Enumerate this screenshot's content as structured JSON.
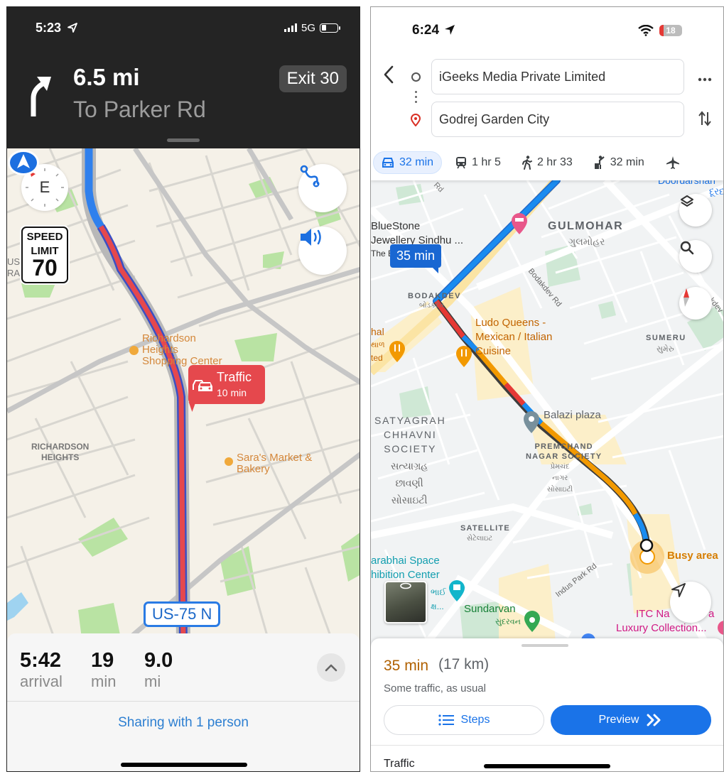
{
  "left": {
    "app": "Apple Maps navigation",
    "status_bar": {
      "time": "5:23",
      "network": "5G",
      "location_icon": "location-arrow-icon"
    },
    "guidance": {
      "maneuver_icon": "turn-slight-right-arrow-icon",
      "distance": "6.5 mi",
      "road": "To Parker Rd",
      "exit_badge": "Exit 30"
    },
    "map": {
      "compass_heading": "E",
      "speed_limit": {
        "line1": "SPEED",
        "line2": "LIMIT",
        "value": "70"
      },
      "buttons": [
        {
          "name": "route-overview-button",
          "icon": "route-icon"
        },
        {
          "name": "audio-button",
          "icon": "speaker-icon"
        }
      ],
      "traffic_callout": {
        "title": "Traffic",
        "delay": "10 min",
        "icon": "cars-icon"
      },
      "labels": {
        "poi_1": [
          "Richardson",
          "Heights",
          "Shopping Center"
        ],
        "poi_2": [
          "Sara's Market &",
          "Bakery"
        ],
        "area": [
          "RICHARDSON",
          "HEIGHTS"
        ],
        "edge_left": [
          "UST",
          "RAI"
        ]
      },
      "road_shield": "US-75 N"
    },
    "trip_card": {
      "arrival_value": "5:42",
      "arrival_label": "arrival",
      "minutes_value": "19",
      "minutes_label": "min",
      "miles_value": "9.0",
      "miles_label": "mi",
      "expand_icon": "chevron-up-icon",
      "share_text": "Sharing with 1 person"
    }
  },
  "right": {
    "app": "Google Maps directions",
    "status_bar": {
      "time": "6:24",
      "battery": "18"
    },
    "origin": "iGeeks Media Private Limited",
    "destination": "Godrej Garden City",
    "modes": [
      {
        "icon": "car-icon",
        "label": "32 min",
        "active": true
      },
      {
        "icon": "transit-icon",
        "label": "1 hr 5"
      },
      {
        "icon": "walk-icon",
        "label": "2 hr 33"
      },
      {
        "icon": "ride-hail-icon",
        "label": "32 min"
      },
      {
        "icon": "flight-icon",
        "label": ""
      }
    ],
    "map": {
      "eta_callout": "35 min",
      "labels": {
        "doordarshan": "Doordarshan",
        "doordarshan_guj": "દૂરદ",
        "rd_top": "Rd",
        "bluestone_1": "BlueStone",
        "bluestone_2": "Jewellery Sindhu ...",
        "bluestone_3": "The B",
        "gulmohar": "GULMOHAR",
        "gulmohar_guj": "ગુલમોહર",
        "bodakdev_rd": "Bodakdev Rd",
        "bodakdev": "BODAKDEV",
        "bodakdev_guj": "બોડકદેવ",
        "hal": "hal",
        "hal_guj": "થાળ",
        "ted": "ted",
        "ludo_1": "Ludo Queens -",
        "ludo_2": "Mexican / Italian",
        "ludo_3": "Cuisine",
        "sumeru": "SUMERU",
        "sumeru_guj": "સુમેરુ",
        "kdev": "kdev",
        "balazi": "Balazi plaza",
        "satyagrah_1": "SATYAGRAH",
        "satyagrah_2": "CHHAVNI",
        "satyagrah_3": "SOCIETY",
        "satyagrah_guj_1": "સત્યાગ્રહ",
        "satyagrah_guj_2": "છાવણી",
        "satyagrah_guj_3": "સોસાઇટી",
        "premchand_1": "PREMCHAND",
        "premchand_2": "NAGAR SOCIETY",
        "premchand_guj_1": "પ્રેમચંદ",
        "premchand_guj_2": "નાગર",
        "premchand_guj_3": "સોસાઇટી",
        "satellite": "SATELLITE",
        "satellite_guj": "સેટેલાઇટ",
        "busy_area": "Busy area",
        "sarabhai_1": "arabhai Space",
        "sarabhai_2": "hibition Center",
        "sarabhai_guj_1": "ભાઈ",
        "sarabhai_guj_2": "ક્ષ...",
        "indus": "Indus Park Rd",
        "sundarvan": "Sundarvan",
        "sundarvan_guj": "સુંદરવન",
        "itc_1": "ITC Na",
        "itc_1b": "a",
        "itc_2": "Luxury Collection..."
      }
    },
    "sheet": {
      "duration": "35 min",
      "distance": "(17 km)",
      "note": "Some traffic, as usual",
      "steps_label": "Steps",
      "preview_label": "Preview",
      "section_title": "Traffic"
    },
    "colors": {
      "route_blue": "#1a8cf0",
      "traffic_red": "#e53935",
      "traffic_orange": "#f29900",
      "accent": "#1a73e8",
      "eta_orange": "#b06000"
    }
  },
  "colors": {
    "apple_route_blue": "#2f80ed",
    "apple_traffic_red": "#e5484d",
    "apple_link": "#2d7fd1"
  }
}
